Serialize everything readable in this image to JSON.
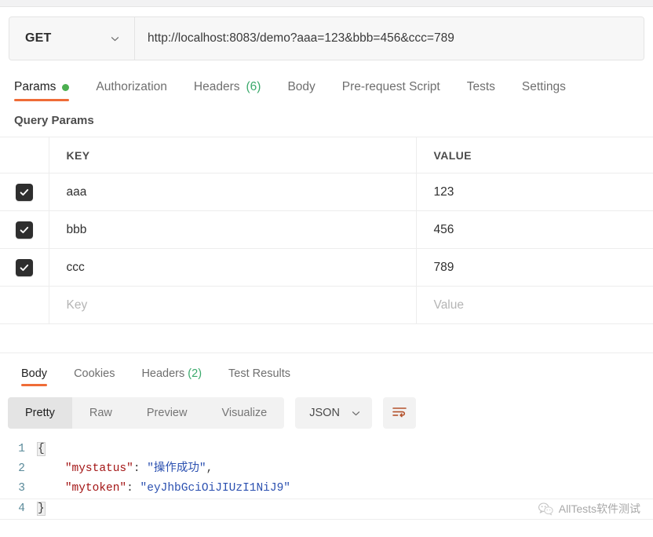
{
  "request": {
    "method": "GET",
    "method_caret_icon": "chevron-down-icon",
    "url": "http://localhost:8083/demo?aaa=123&bbb=456&ccc=789",
    "tabs": [
      {
        "label": "Params",
        "badge": "",
        "indicator": "dot",
        "active": true
      },
      {
        "label": "Authorization",
        "badge": "",
        "indicator": "",
        "active": false
      },
      {
        "label": "Headers",
        "badge": "(6)",
        "indicator": "",
        "active": false
      },
      {
        "label": "Body",
        "badge": "",
        "indicator": "",
        "active": false
      },
      {
        "label": "Pre-request Script",
        "badge": "",
        "indicator": "",
        "active": false
      },
      {
        "label": "Tests",
        "badge": "",
        "indicator": "",
        "active": false
      },
      {
        "label": "Settings",
        "badge": "",
        "indicator": "",
        "active": false
      }
    ]
  },
  "query_params": {
    "title": "Query Params",
    "columns": {
      "key": "KEY",
      "value": "VALUE"
    },
    "rows": [
      {
        "checked": true,
        "key": "aaa",
        "value": "123"
      },
      {
        "checked": true,
        "key": "bbb",
        "value": "456"
      },
      {
        "checked": true,
        "key": "ccc",
        "value": "789"
      }
    ],
    "placeholder_row": {
      "key": "Key",
      "value": "Value"
    }
  },
  "response": {
    "tabs": [
      {
        "label": "Body",
        "badge": "",
        "active": true
      },
      {
        "label": "Cookies",
        "badge": "",
        "active": false
      },
      {
        "label": "Headers",
        "badge": "(2)",
        "active": false
      },
      {
        "label": "Test Results",
        "badge": "",
        "active": false
      }
    ],
    "view_modes": [
      {
        "label": "Pretty",
        "active": true
      },
      {
        "label": "Raw",
        "active": false
      },
      {
        "label": "Preview",
        "active": false
      },
      {
        "label": "Visualize",
        "active": false
      }
    ],
    "format": "JSON",
    "format_caret_icon": "chevron-down-icon",
    "wrap_button_icon": "word-wrap-icon",
    "body_lines": [
      {
        "num": "1",
        "segments": [
          {
            "text": "{",
            "type": "brace"
          }
        ]
      },
      {
        "num": "2",
        "segments": [
          {
            "text": "    ",
            "type": "plain"
          },
          {
            "text": "\"mystatus\"",
            "type": "key"
          },
          {
            "text": ": ",
            "type": "punc"
          },
          {
            "text": "\"操作成功\"",
            "type": "str"
          },
          {
            "text": ",",
            "type": "punc"
          }
        ]
      },
      {
        "num": "3",
        "segments": [
          {
            "text": "    ",
            "type": "plain"
          },
          {
            "text": "\"mytoken\"",
            "type": "key"
          },
          {
            "text": ": ",
            "type": "punc"
          },
          {
            "text": "\"eyJhbGciOiJIUzI1NiJ9\"",
            "type": "str"
          }
        ]
      },
      {
        "num": "4",
        "segments": [
          {
            "text": "}",
            "type": "brace"
          }
        ]
      }
    ]
  },
  "watermark": {
    "icon": "wechat-icon",
    "text": "AllTests软件测试"
  },
  "colors": {
    "accent": "#ef6c37",
    "dot_green": "#4caf50",
    "badge_green": "#3aa96b",
    "checkbox": "#2e2e2e",
    "json_key": "#a31515",
    "json_string": "#2b50b0",
    "line_number": "#5a8a9a"
  }
}
